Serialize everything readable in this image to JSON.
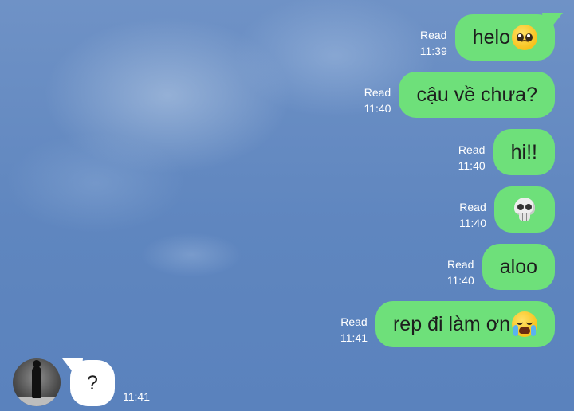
{
  "messages": [
    {
      "read": "Read",
      "time": "11:39",
      "text": "helo",
      "emoji": "pleading-face"
    },
    {
      "read": "Read",
      "time": "11:40",
      "text": "cậu về chưa?"
    },
    {
      "read": "Read",
      "time": "11:40",
      "text": "hi!!"
    },
    {
      "read": "Read",
      "time": "11:40",
      "text": "",
      "emoji": "skull"
    },
    {
      "read": "Read",
      "time": "11:40",
      "text": "aloo"
    },
    {
      "read": "Read",
      "time": "11:41",
      "text": "rep đi làm ơn",
      "emoji": "loudly-crying-face"
    }
  ],
  "incoming": {
    "text": "?",
    "time": "11:41"
  },
  "colors": {
    "outgoing_bubble": "#6ee07a",
    "incoming_bubble": "#ffffff",
    "background": "#5f87c0"
  }
}
